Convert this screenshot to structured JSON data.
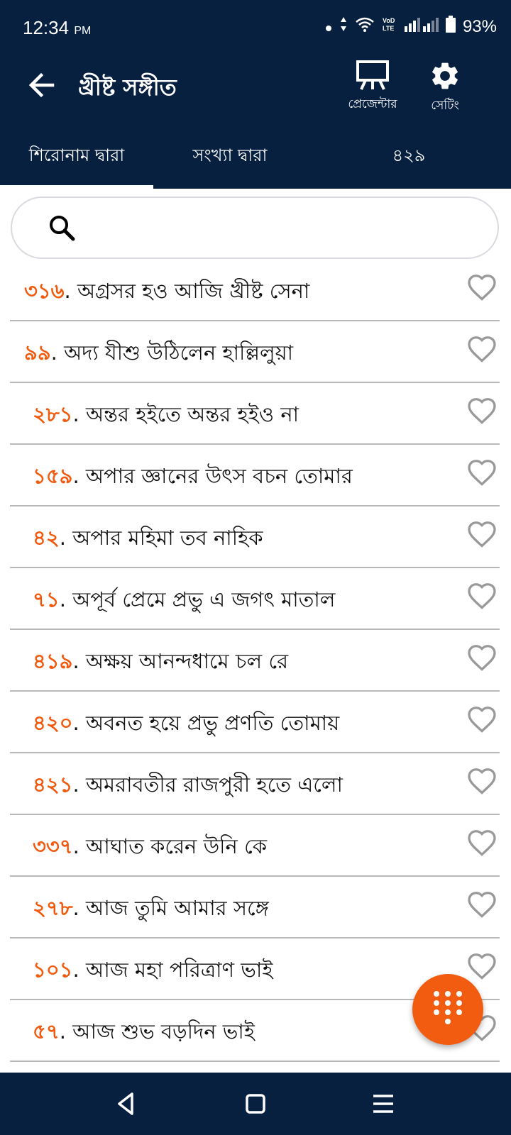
{
  "status_bar": {
    "time": "12:34",
    "ampm": "PM",
    "battery": "93%"
  },
  "app_bar": {
    "title": "খ্রীষ্ট সঙ্গীত",
    "presenter_label": "প্রেজেন্টার",
    "settings_label": "সেটিং"
  },
  "tabs": [
    {
      "label": "শিরোনাম দ্বারা",
      "selected": true
    },
    {
      "label": "সংখ্যা দ্বারা",
      "selected": false
    },
    {
      "label": "৪২৯",
      "selected": false
    }
  ],
  "search": {
    "value": "",
    "placeholder": ""
  },
  "songs": [
    {
      "number": "৩১৬",
      "title": "অগ্রসর হও আজি খ্রীষ্ট সেনা"
    },
    {
      "number": "৯৯",
      "title": "অদ্য যীশু উঠিলেন হাল্লিলুয়া"
    },
    {
      "number": "২৮১",
      "title": "অন্তর হইতে অন্তর হইও না"
    },
    {
      "number": "১৫৯",
      "title": "অপার জ্ঞানের উৎস বচন তোমার"
    },
    {
      "number": "৪২",
      "title": "অপার মহিমা তব নাহিক"
    },
    {
      "number": "৭১",
      "title": "অপূর্ব প্রেমে প্রভু এ জগৎ মাতাল"
    },
    {
      "number": "৪১৯",
      "title": "অক্ষয় আনন্দধামে চল রে"
    },
    {
      "number": "৪২০",
      "title": "অবনত হয়ে প্রভু প্রণতি তোমায়"
    },
    {
      "number": "৪২১",
      "title": "অমরাবতীর রাজপুরী হতে এলো"
    },
    {
      "number": "৩৩৭",
      "title": "আঘাত করেন উনি কে"
    },
    {
      "number": "২৭৮",
      "title": "আজ তুমি আমার সঙ্গে"
    },
    {
      "number": "১০১",
      "title": "আজ মহা পরিত্রাণ ভাই"
    },
    {
      "number": "৫৭",
      "title": "আজ শুভ বড়দিন ভাই"
    }
  ],
  "colors": {
    "primary": "#07203f",
    "accent": "#f15a0e",
    "heart": "#999999"
  },
  "icons": {
    "back": "arrow-left-icon",
    "presenter": "presenter-easel-icon",
    "settings": "gear-icon",
    "search": "search-icon",
    "favorite": "heart-outline-icon",
    "fab": "dialpad-icon"
  }
}
